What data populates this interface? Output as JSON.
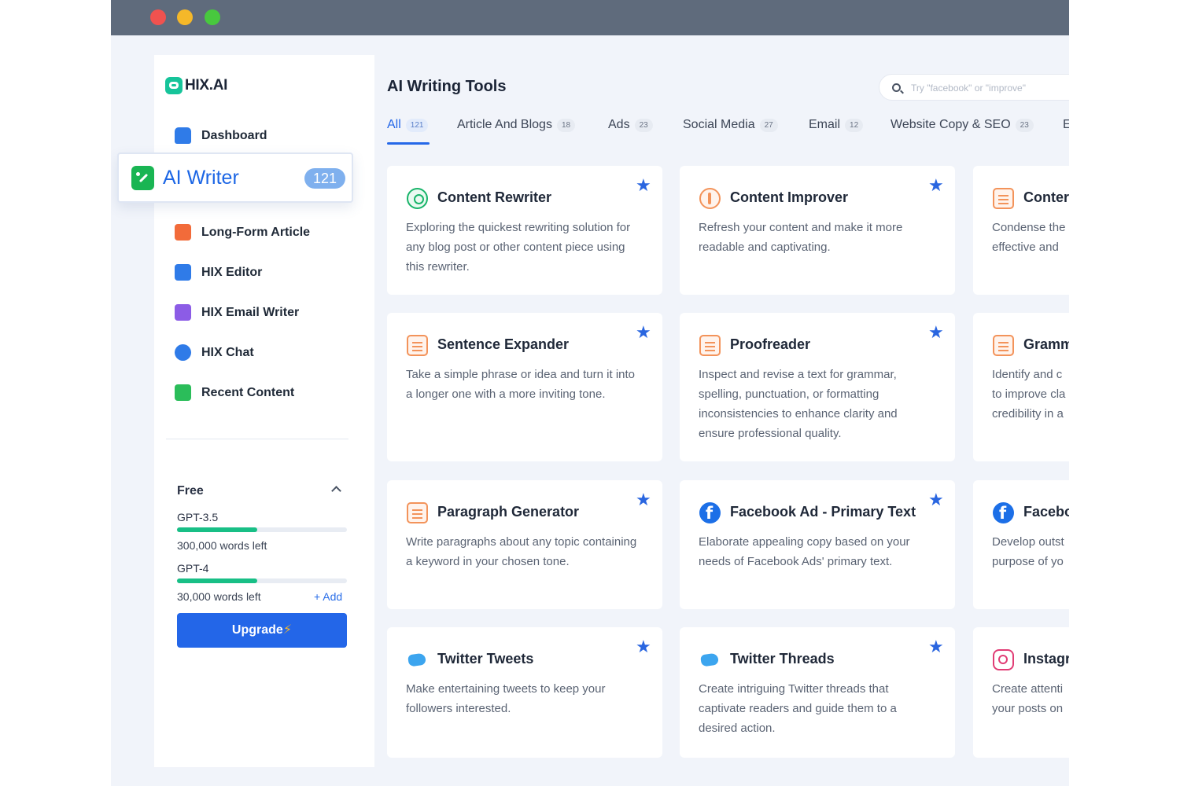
{
  "brand": {
    "name": "HIX.AI"
  },
  "sidebar": {
    "dashboard": "Dashboard",
    "active": {
      "label": "AI Writer",
      "count": "121"
    },
    "items": [
      {
        "label": "Long-Form Article",
        "icon": "document-edit-icon",
        "color": "#f26b3a"
      },
      {
        "label": "HIX Editor",
        "icon": "editor-icon",
        "color": "#2f7be8"
      },
      {
        "label": "HIX Email Writer",
        "icon": "email-writer-icon",
        "color": "#8c5ce6"
      },
      {
        "label": "HIX Chat",
        "icon": "chat-icon",
        "color": "#2f7be8"
      },
      {
        "label": "Recent Content",
        "icon": "file-icon",
        "color": "#2bbd5a"
      }
    ]
  },
  "plan": {
    "title": "Free",
    "models": [
      {
        "name": "GPT-3.5",
        "left": "300,000 words left",
        "usage_fraction": 0.47
      },
      {
        "name": "GPT-4",
        "left": "30,000 words left",
        "usage_fraction": 0.47
      }
    ],
    "add": "+ Add",
    "upgrade": "Upgrade"
  },
  "main": {
    "title": "AI Writing Tools",
    "search_placeholder": "Try \"facebook\" or \"improve\"",
    "tabs": [
      {
        "label": "All",
        "count": "121"
      },
      {
        "label": "Article And Blogs",
        "count": "18"
      },
      {
        "label": "Ads",
        "count": "23"
      },
      {
        "label": "Social Media",
        "count": "27"
      },
      {
        "label": "Email",
        "count": "12"
      },
      {
        "label": "Website Copy & SEO",
        "count": "23"
      },
      {
        "label": "E",
        "count": ""
      }
    ],
    "cards": [
      {
        "title": "Content Rewriter",
        "desc": "Exploring the quickest rewriting solution for any blog post or other content piece using this rewriter.",
        "icon": "rewrite-icon"
      },
      {
        "title": "Content Improver",
        "desc": "Refresh your content and make it more readable and captivating.",
        "icon": "improve-icon"
      },
      {
        "title": "Conter",
        "desc": "Condense the effective and",
        "icon": "summary-icon"
      },
      {
        "title": "Sentence Expander",
        "desc": "Take a simple phrase or idea and turn it into a longer one with a more inviting tone.",
        "icon": "expand-icon"
      },
      {
        "title": "Proofreader",
        "desc": "Inspect and revise a text for grammar, spelling, punctuation, or formatting inconsistencies to enhance clarity and ensure professional quality.",
        "icon": "proofread-icon"
      },
      {
        "title": "Gramm",
        "desc": "Identify and c to improve cla credibility in a",
        "icon": "grammar-icon"
      },
      {
        "title": "Paragraph Generator",
        "desc": "Write paragraphs about any topic containing a keyword in your chosen tone.",
        "icon": "paragraph-icon"
      },
      {
        "title": "Facebook Ad - Primary Text",
        "desc": "Elaborate appealing copy based on your needs of Facebook Ads' primary text.",
        "icon": "facebook-icon"
      },
      {
        "title": "Facebo",
        "desc": "Develop outst purpose of yo",
        "icon": "facebook-icon"
      },
      {
        "title": "Twitter Tweets",
        "desc": "Make entertaining tweets to keep your followers interested.",
        "icon": "twitter-icon"
      },
      {
        "title": "Twitter Threads",
        "desc": "Create intriguing Twitter threads that captivate readers and guide them to a desired action.",
        "icon": "twitter-icon"
      },
      {
        "title": "Instagr",
        "desc": "Create attenti your posts on",
        "icon": "instagram-icon"
      }
    ]
  },
  "colors": {
    "accent": "#2366e8",
    "active_green": "#19b553",
    "progress": "#18bf86"
  }
}
